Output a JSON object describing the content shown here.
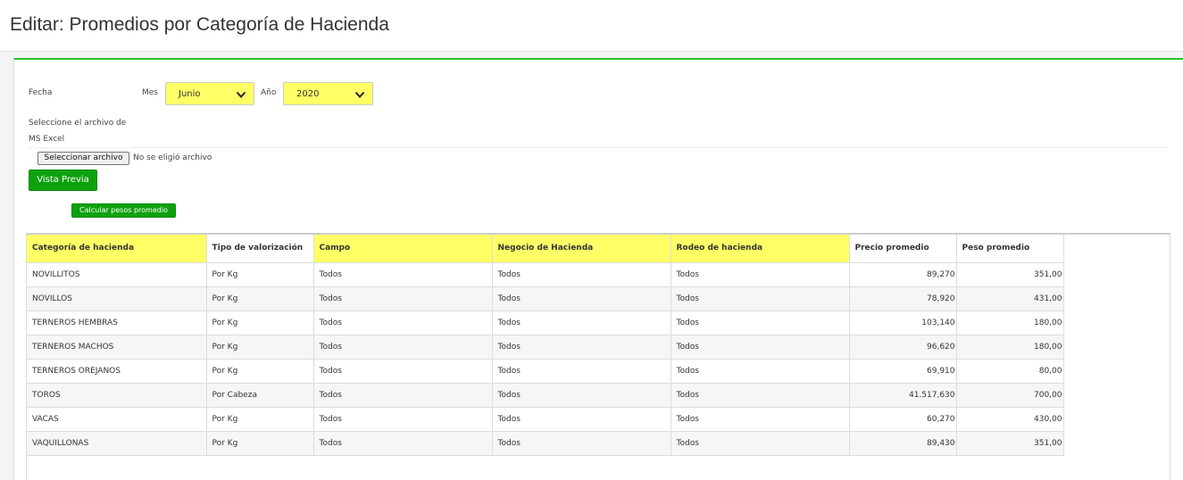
{
  "header": {
    "title": "Editar: Promedios por Categoría de Hacienda"
  },
  "form": {
    "fecha_label": "Fecha",
    "mes_label": "Mes",
    "mes_value": "Junio",
    "anio_label": "Año",
    "anio_value": "2020",
    "file_label_line1": "Seleccione el archivo de",
    "file_label_line2": "MS Excel",
    "file_button": "Seleccionar archivo",
    "file_status": "No se eligió archivo",
    "preview_button": "Vista Previa",
    "calc_button": "Calcular pesos promedio"
  },
  "colors": {
    "accent_green": "#27c227",
    "button_green": "#0ea10e",
    "highlight_yellow": "#ffff66"
  },
  "table": {
    "columns": [
      {
        "label": "Categoría de hacienda",
        "highlighted": true
      },
      {
        "label": "Tipo de valorización",
        "highlighted": false
      },
      {
        "label": "Campo",
        "highlighted": true
      },
      {
        "label": "Negocio de Hacienda",
        "highlighted": true
      },
      {
        "label": "Rodeo de hacienda",
        "highlighted": true
      },
      {
        "label": "Precio promedio",
        "highlighted": false
      },
      {
        "label": "Peso promedio",
        "highlighted": false
      }
    ],
    "rows": [
      [
        "NOVILLITOS",
        "Por Kg",
        "Todos",
        "Todos",
        "Todos",
        "89,270",
        "351,00"
      ],
      [
        "NOVILLOS",
        "Por Kg",
        "Todos",
        "Todos",
        "Todos",
        "78,920",
        "431,00"
      ],
      [
        "TERNEROS HEMBRAS",
        "Por Kg",
        "Todos",
        "Todos",
        "Todos",
        "103,140",
        "180,00"
      ],
      [
        "TERNEROS MACHOS",
        "Por Kg",
        "Todos",
        "Todos",
        "Todos",
        "96,620",
        "180,00"
      ],
      [
        "TERNEROS OREJANOS",
        "Por Kg",
        "Todos",
        "Todos",
        "Todos",
        "69,910",
        "80,00"
      ],
      [
        "TOROS",
        "Por Cabeza",
        "Todos",
        "Todos",
        "Todos",
        "41.517,630",
        "700,00"
      ],
      [
        "VACAS",
        "Por Kg",
        "Todos",
        "Todos",
        "Todos",
        "60,270",
        "430,00"
      ],
      [
        "VAQUILLONAS",
        "Por Kg",
        "Todos",
        "Todos",
        "Todos",
        "89,430",
        "351,00"
      ]
    ]
  }
}
